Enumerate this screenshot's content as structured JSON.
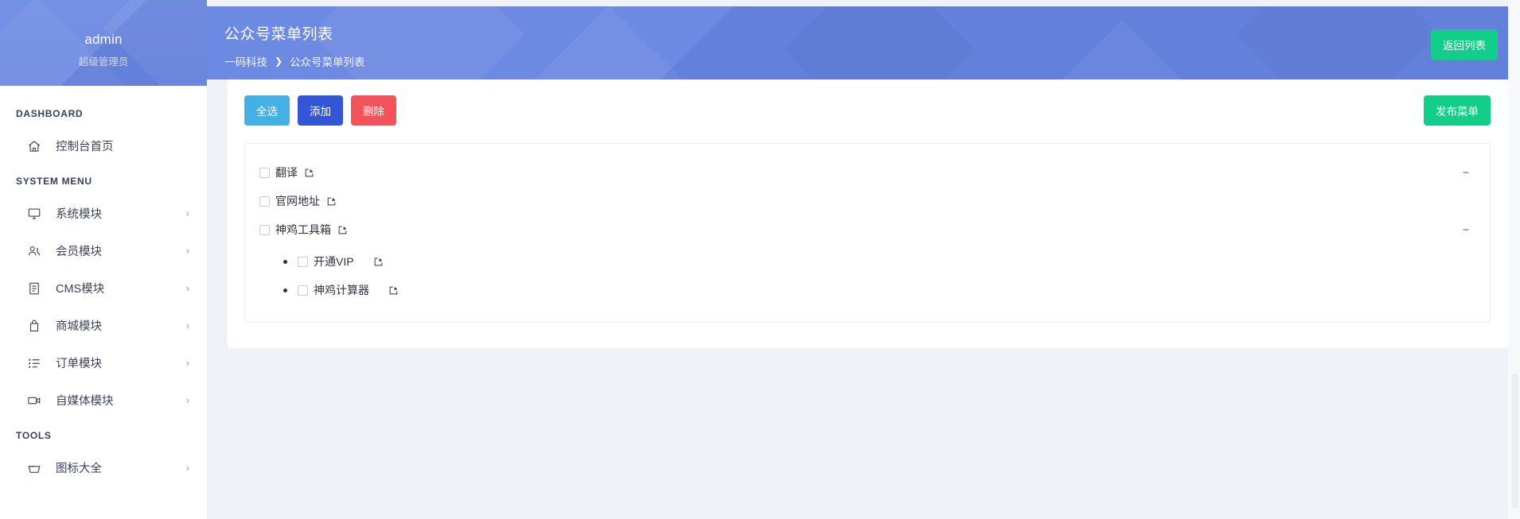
{
  "sidebar": {
    "profile": {
      "name": "admin",
      "role": "超级管理员"
    },
    "sections": [
      {
        "heading": "DASHBOARD",
        "items": [
          {
            "label": "控制台首页",
            "icon": "home-icon",
            "has_arrow": false
          }
        ]
      },
      {
        "heading": "SYSTEM MENU",
        "items": [
          {
            "label": "系统模块",
            "icon": "monitor-icon",
            "has_arrow": true,
            "arrow": "›"
          },
          {
            "label": "会员模块",
            "icon": "users-icon",
            "has_arrow": true,
            "arrow": "›"
          },
          {
            "label": "CMS模块",
            "icon": "document-icon",
            "has_arrow": true,
            "arrow": "›"
          },
          {
            "label": "商城模块",
            "icon": "bag-icon",
            "has_arrow": true,
            "arrow": "›"
          },
          {
            "label": "订单模块",
            "icon": "list-icon",
            "has_arrow": true,
            "arrow": "›"
          },
          {
            "label": "自媒体模块",
            "icon": "video-icon",
            "has_arrow": true,
            "arrow": "›"
          }
        ]
      },
      {
        "heading": "TOOLS",
        "items": [
          {
            "label": "图标大全",
            "icon": "basket-icon",
            "has_arrow": true,
            "arrow": "›"
          }
        ]
      }
    ]
  },
  "header": {
    "title": "公众号菜单列表",
    "breadcrumb": {
      "root": "一码科技",
      "separator": "❯",
      "current": "公众号菜单列表"
    },
    "return_button": "返回列表"
  },
  "toolbar": {
    "select_all": "全选",
    "add": "添加",
    "delete": "删除",
    "publish": "发布菜单"
  },
  "menu": {
    "collapse_symbol": "−",
    "items": [
      {
        "label": "翻译",
        "checked": false,
        "collapsible": true,
        "children": []
      },
      {
        "label": "官网地址",
        "checked": false,
        "collapsible": false,
        "children": []
      },
      {
        "label": "神鸡工具箱",
        "checked": false,
        "collapsible": true,
        "children": [
          {
            "label": "开通VIP",
            "checked": false
          },
          {
            "label": "神鸡计算器",
            "checked": false
          }
        ]
      }
    ]
  },
  "colors": {
    "header_blue": "#6583e0",
    "select_all_btn": "#45b0e3",
    "add_btn": "#3356d6",
    "delete_btn": "#f2535b",
    "green_btn": "#13ce89",
    "page_bg": "#f1f2f7"
  }
}
